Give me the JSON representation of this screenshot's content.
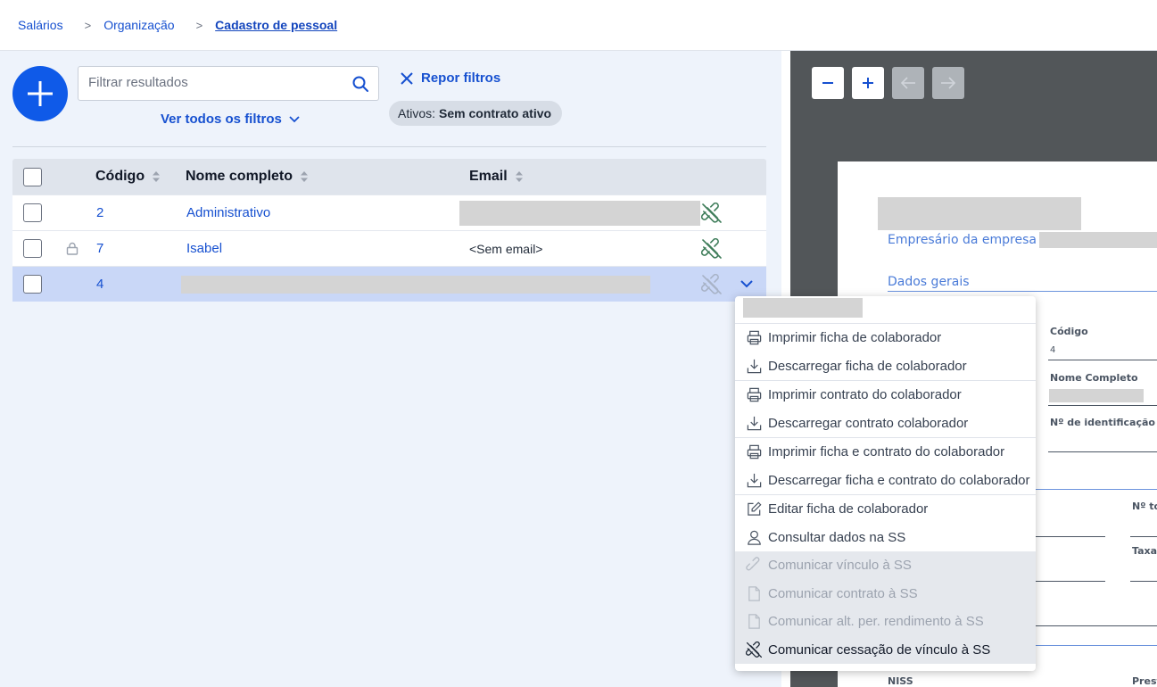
{
  "breadcrumb": {
    "items": [
      "Salários",
      "Organização",
      "Cadastro de pessoal"
    ],
    "separator": ">"
  },
  "toolbar": {
    "search_placeholder": "Filtrar resultados",
    "see_all_filters": "Ver todos os filtros",
    "reset_filters": "Repor filtros",
    "chip_label": "Ativos:",
    "chip_value": "Sem contrato ativo"
  },
  "table": {
    "columns": {
      "code": "Código",
      "name": "Nome completo",
      "email": "Email"
    },
    "rows": [
      {
        "code": "2",
        "name": "Administrativo",
        "email": ""
      },
      {
        "code": "7",
        "name": "Isabel",
        "email": "<Sem email>"
      },
      {
        "code": "4",
        "name": "",
        "email": ""
      }
    ]
  },
  "menu": {
    "items": [
      "Imprimir ficha de colaborador",
      "Descarregar ficha de colaborador",
      "Imprimir contrato do colaborador",
      "Descarregar contrato colaborador",
      "Imprimir ficha e contrato do colaborador",
      "Descarregar ficha e contrato do colaborador",
      "Editar ficha de colaborador",
      "Consultar dados na SS",
      "Comunicar vínculo à SS",
      "Comunicar contrato à SS",
      "Comunicar alt. per. rendimento à SS",
      "Comunicar cessação de vínculo à SS"
    ]
  },
  "document": {
    "employer_label": "Empresário da empresa",
    "section_general": "Dados gerais",
    "code_label": "Código",
    "code_value": "4",
    "full_name_label": "Nome Completo",
    "id_number_label": "Nº de identificação",
    "right_label_1": "Nº to",
    "right_label_2": "Taxa",
    "niss_label": "NISS",
    "prest_label": "Prest"
  },
  "viewer": {
    "zoom_out": "−",
    "zoom_in": "+"
  },
  "colors": {
    "accent": "#0f5ae8",
    "link": "#1650d0",
    "selected_row": "#c9d7f7",
    "viewer_bg": "#525659"
  }
}
